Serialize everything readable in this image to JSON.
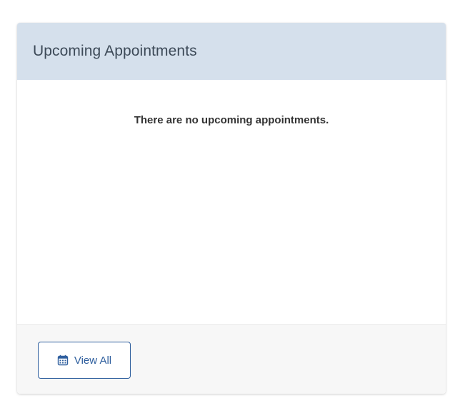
{
  "card": {
    "title": "Upcoming Appointments",
    "empty_message": "There are no upcoming appointments.",
    "footer": {
      "view_all_label": "View All",
      "view_all_icon": "calendar-icon"
    }
  },
  "colors": {
    "header_bg": "#d5e0ec",
    "button_accent": "#2f5f9e",
    "footer_bg": "#f7f7f7"
  }
}
